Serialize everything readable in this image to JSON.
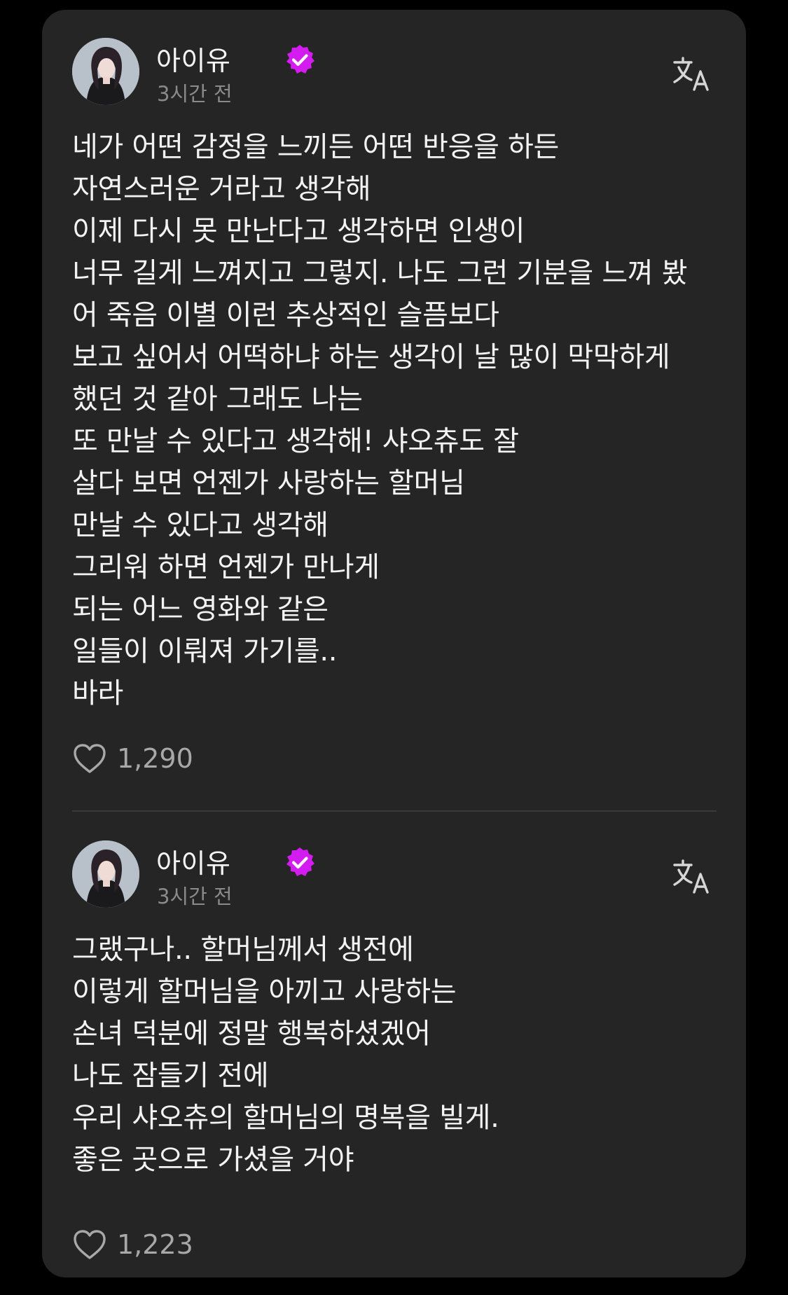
{
  "colors": {
    "background": "#000000",
    "card": "#252525",
    "text": "#f3f3f3",
    "muted": "#8a8a8a",
    "verified_badge": "#d21cf0"
  },
  "icons": {
    "verified": "verified-badge-icon",
    "translate": "translate-icon",
    "like": "heart-outline-icon"
  },
  "posts": [
    {
      "author": "아이유",
      "timestamp": "3시간 전",
      "lines": [
        "네가 어떤 감정을 느끼든 어떤 반응을 하든",
        "자연스러운 거라고 생각해",
        "이제 다시 못 만난다고 생각하면 인생이",
        "너무 길게 느껴지고 그렇지. 나도 그런 기분을 느껴 봤",
        "어 죽음 이별 이런 추상적인 슬픔보다",
        "보고 싶어서 어떡하냐 하는 생각이 날 많이 막막하게",
        "했던 것 같아 그래도 나는",
        "또 만날 수 있다고 생각해! 샤오츄도 잘",
        "살다 보면 언젠가 사랑하는 할머님",
        "만날 수 있다고 생각해",
        "그리워 하면 언젠가 만나게",
        "되는 어느 영화와 같은",
        "일들이 이뤄져 가기를..",
        "바라"
      ],
      "likes": "1,290"
    },
    {
      "author": "아이유",
      "timestamp": "3시간 전",
      "lines": [
        "그랬구나.. 할머님께서 생전에",
        "이렇게 할머님을 아끼고 사랑하는",
        "손녀 덕분에 정말 행복하셨겠어",
        "나도 잠들기 전에",
        "우리 샤오츄의 할머님의 명복을 빌게.",
        "좋은 곳으로 가셨을 거야"
      ],
      "likes": "1,223"
    }
  ]
}
